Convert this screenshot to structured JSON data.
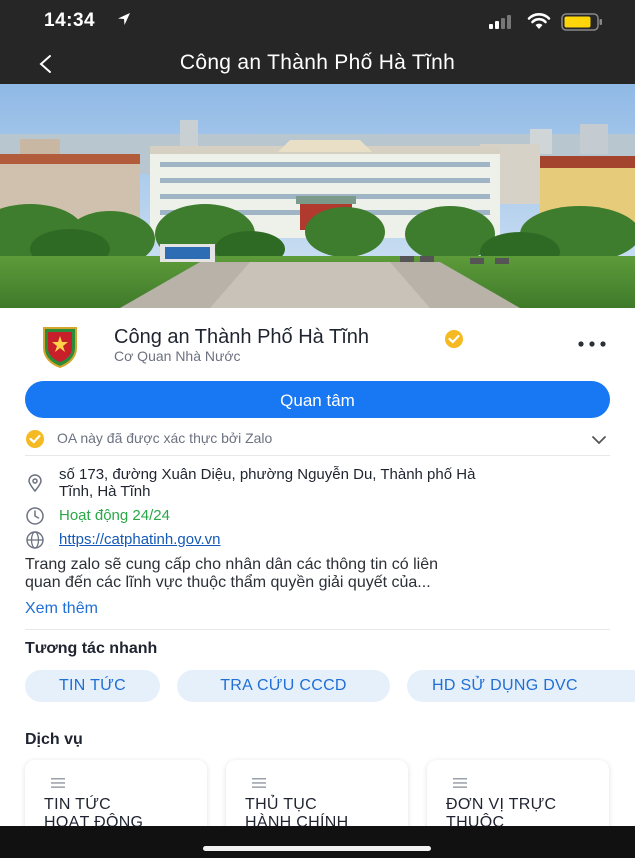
{
  "status": {
    "time": "14:34",
    "battery_color": "#ffd60a"
  },
  "nav": {
    "title": "Công an Thành Phố Hà Tĩnh"
  },
  "profile": {
    "name": "Công an Thành Phố Hà Tĩnh",
    "type": "Cơ Quan Nhà Nước",
    "follow_label": "Quan tâm",
    "verified_text": "OA này đã được xác thực bởi Zalo"
  },
  "info": {
    "address_line1": "số 173, đường Xuân Diệu, phường Nguyễn Du, Thành phố Hà",
    "address_line2": "Tĩnh, Hà Tĩnh",
    "hours": "Hoạt động 24/24",
    "website": "https://catphatinh.gov.vn"
  },
  "description": {
    "line1": "Trang zalo sẽ cung cấp cho nhân dân các thông tin có liên",
    "line2": "quan đến các lĩnh vực thuộc thẩm quyền giải quyết của...",
    "see_more": "Xem thêm"
  },
  "quick_actions": {
    "title": "Tương tác nhanh",
    "chips": [
      "TIN TỨC",
      "TRA CỨU CCCD",
      "HD SỬ DỤNG DVC"
    ]
  },
  "services": {
    "title": "Dịch vụ",
    "cards": [
      {
        "line1": "TIN TỨC",
        "line2": "HOẠT ĐỘNG"
      },
      {
        "line1": "THỦ TỤC",
        "line2": "HÀNH CHÍNH"
      },
      {
        "line1": "ĐƠN VỊ TRỰC",
        "line2": "THUỘC"
      }
    ]
  },
  "colors": {
    "accent": "#1877f2",
    "chip_bg": "#e6f0fb",
    "hours_green": "#2aa847",
    "badge_gold": "#f5b921"
  }
}
